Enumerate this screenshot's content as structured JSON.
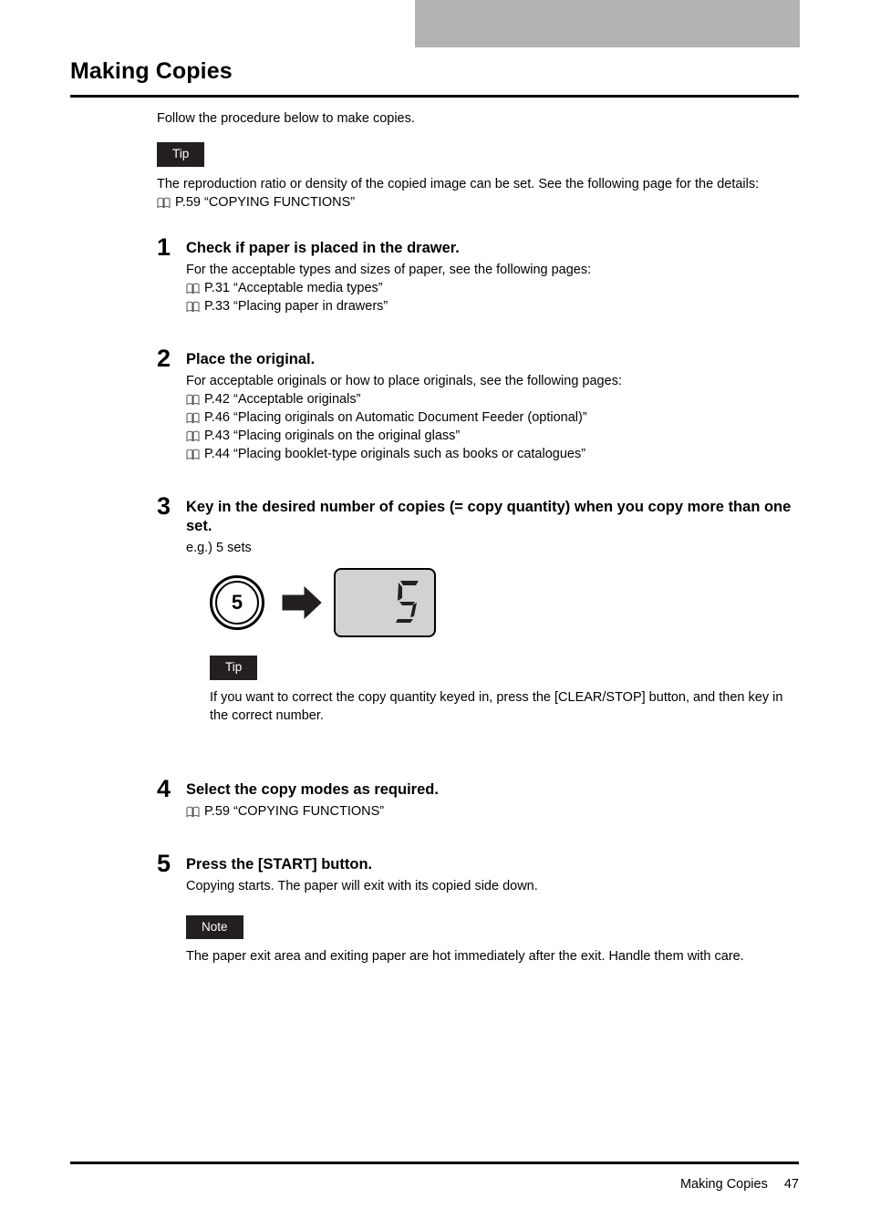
{
  "page": {
    "title": "Making Copies",
    "intro": "Follow the procedure below to make copies."
  },
  "tab_marker": {
    "color": "#b3b3b3",
    "label": ""
  },
  "intro_tip": {
    "label": "Tip",
    "body": "The reproduction ratio or density of the copied image can be set. See the following page for the details:",
    "reference": "P.59 “COPYING FUNCTIONS”",
    "icon": "book-icon"
  },
  "steps": [
    {
      "number": "1",
      "title": "Check if paper is placed in the drawer.",
      "text": "For the acceptable types and sizes of paper, see the following pages:",
      "references": [
        "P.31 “Acceptable media types”",
        "P.33 “Placing paper in drawers”"
      ]
    },
    {
      "number": "2",
      "title": "Place the original.",
      "text": "For acceptable originals or how to place originals, see the following pages:",
      "references": [
        "P.42 “Acceptable originals”",
        "P.46 “Placing originals on Automatic Document Feeder (optional)”",
        "P.43 “Placing originals on the original glass”",
        "P.44 “Placing booklet-type originals such as books or catalogues”"
      ]
    },
    {
      "number": "3",
      "title": "Key in the desired number of copies (= copy quantity) when you copy more than one set.",
      "text": "e.g.) 5 sets",
      "references": []
    },
    {
      "number": "4",
      "title": "Select the copy modes as required.",
      "text": "",
      "references": [
        "P.59 “COPYING FUNCTIONS”"
      ]
    },
    {
      "number": "5",
      "title": "Press the [START] button.",
      "text": "Copying starts. The paper will exit with its copied side down.",
      "references": []
    }
  ],
  "figure": {
    "key_label": "5",
    "arrow_icon": "right-arrow-icon",
    "display_value": "5",
    "display_background": "#d2d2d2"
  },
  "step3_tip": {
    "label": "Tip",
    "body": "If you want to correct the copy quantity keyed in, press the [CLEAR/STOP] button, and then key in the correct number."
  },
  "step5_note": {
    "label": "Note",
    "body": "The paper exit area and exiting paper are hot immediately after the exit. Handle them with care."
  },
  "footer": {
    "section": "Making Copies",
    "page_number": "47"
  }
}
